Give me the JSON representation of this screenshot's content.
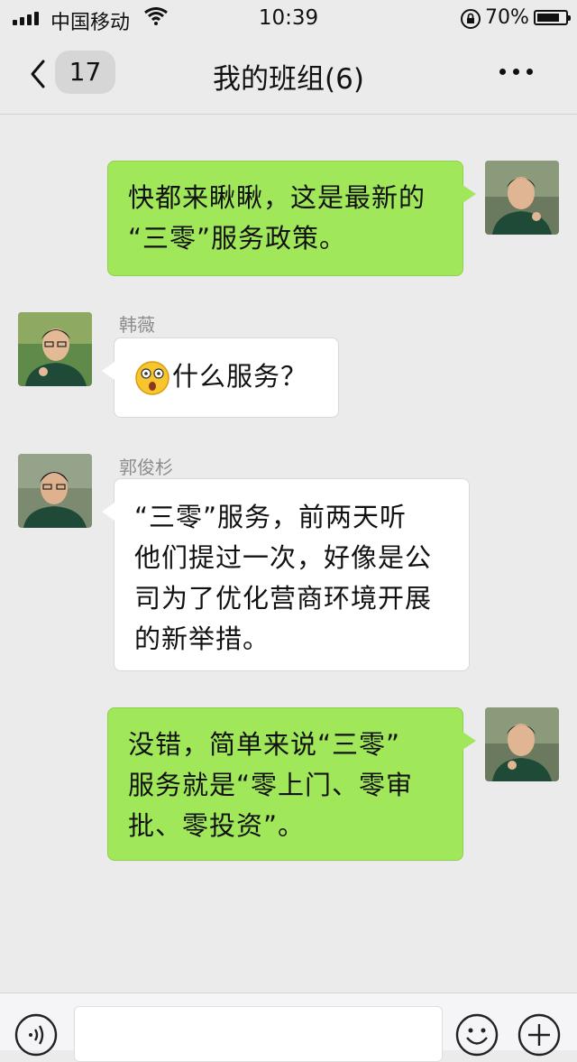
{
  "status_bar": {
    "carrier": "中国移动",
    "time": "10:39",
    "battery_percent": "70%",
    "battery_level": 0.7
  },
  "nav": {
    "unread_count": "17",
    "title": "我的班组(6)"
  },
  "messages": [
    {
      "side": "self",
      "sender": "",
      "lines": [
        "快都来瞅瞅，这是最新的",
        "“三零”服务政策。"
      ]
    },
    {
      "side": "other",
      "sender": "韩薇",
      "emoji": "shocked-face-icon",
      "lines": [
        "什么服务？"
      ]
    },
    {
      "side": "other",
      "sender": "郭俊杉",
      "lines": [
        "“三零”服务，前两天听",
        "他们提过一次，好像是公",
        "司为了优化营商环境开展",
        "的新举措。"
      ]
    },
    {
      "side": "self",
      "sender": "",
      "lines": [
        "没错，简单来说“三零”",
        "服务就是“零上门、零审",
        "批、零投资”。"
      ]
    }
  ],
  "input_bar": {
    "text_value": "",
    "icons": [
      "voice-icon",
      "emoji-icon",
      "plus-icon"
    ]
  },
  "colors": {
    "self_bubble": "#a0e75a",
    "other_bubble": "#ffffff",
    "background": "#ebebeb"
  }
}
